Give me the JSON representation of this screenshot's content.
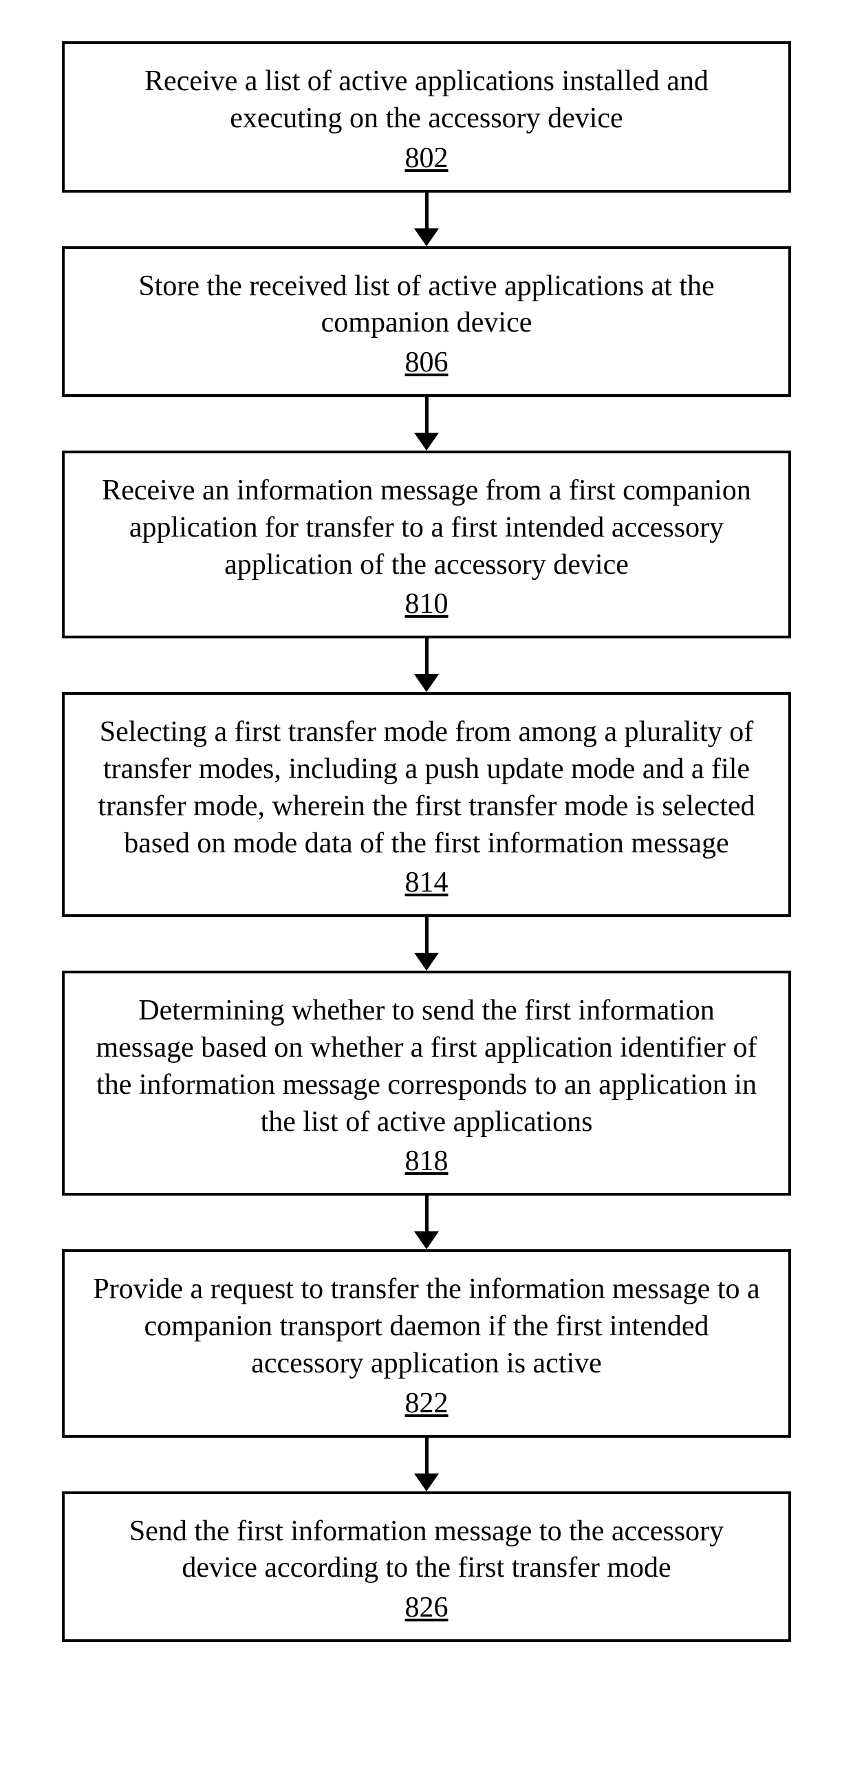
{
  "steps": [
    {
      "text": "Receive a list of active applications installed and executing on the accessory device",
      "num": "802"
    },
    {
      "text": "Store the received list of active applications at the companion device",
      "num": "806"
    },
    {
      "text": "Receive an information message from a first companion application for transfer to a first intended accessory application of the accessory device",
      "num": "810"
    },
    {
      "text": "Selecting a first transfer mode from among a plurality of transfer modes, including a push update mode and a file transfer mode, wherein the first transfer mode is selected based on mode data of the first information message",
      "num": "814"
    },
    {
      "text": "Determining whether to send the first information message based on whether a first application identifier of the information message corresponds to an application in the list of active applications",
      "num": "818"
    },
    {
      "text": "Provide a request to transfer the information message to a companion transport daemon if the first intended accessory application is active",
      "num": "822"
    },
    {
      "text": "Send the first information message to the accessory device according to the first transfer mode",
      "num": "826"
    }
  ]
}
